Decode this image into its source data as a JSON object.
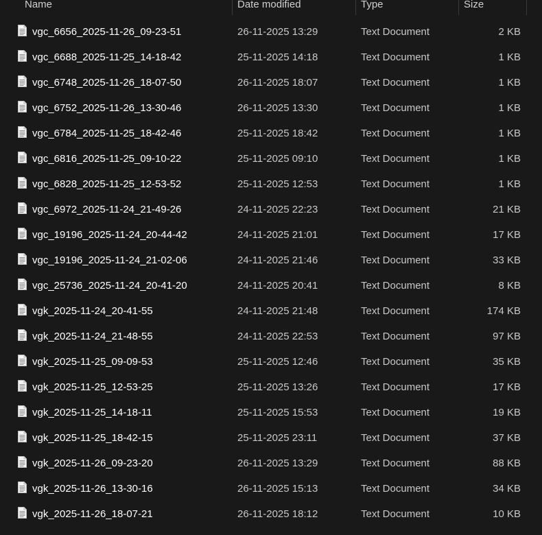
{
  "columns": {
    "name": "Name",
    "date": "Date modified",
    "type": "Type",
    "size": "Size"
  },
  "icon": "text-file-icon",
  "rows": [
    {
      "name": "vgc_6656_2025-11-26_09-23-51",
      "date": "26-11-2025 13:29",
      "type": "Text Document",
      "size": "2 KB"
    },
    {
      "name": "vgc_6688_2025-11-25_14-18-42",
      "date": "25-11-2025 14:18",
      "type": "Text Document",
      "size": "1 KB"
    },
    {
      "name": "vgc_6748_2025-11-26_18-07-50",
      "date": "26-11-2025 18:07",
      "type": "Text Document",
      "size": "1 KB"
    },
    {
      "name": "vgc_6752_2025-11-26_13-30-46",
      "date": "26-11-2025 13:30",
      "type": "Text Document",
      "size": "1 KB"
    },
    {
      "name": "vgc_6784_2025-11-25_18-42-46",
      "date": "25-11-2025 18:42",
      "type": "Text Document",
      "size": "1 KB"
    },
    {
      "name": "vgc_6816_2025-11-25_09-10-22",
      "date": "25-11-2025 09:10",
      "type": "Text Document",
      "size": "1 KB"
    },
    {
      "name": "vgc_6828_2025-11-25_12-53-52",
      "date": "25-11-2025 12:53",
      "type": "Text Document",
      "size": "1 KB"
    },
    {
      "name": "vgc_6972_2025-11-24_21-49-26",
      "date": "24-11-2025 22:23",
      "type": "Text Document",
      "size": "21 KB"
    },
    {
      "name": "vgc_19196_2025-11-24_20-44-42",
      "date": "24-11-2025 21:01",
      "type": "Text Document",
      "size": "17 KB"
    },
    {
      "name": "vgc_19196_2025-11-24_21-02-06",
      "date": "24-11-2025 21:46",
      "type": "Text Document",
      "size": "33 KB"
    },
    {
      "name": "vgc_25736_2025-11-24_20-41-20",
      "date": "24-11-2025 20:41",
      "type": "Text Document",
      "size": "8 KB"
    },
    {
      "name": "vgk_2025-11-24_20-41-55",
      "date": "24-11-2025 21:48",
      "type": "Text Document",
      "size": "174 KB"
    },
    {
      "name": "vgk_2025-11-24_21-48-55",
      "date": "24-11-2025 22:53",
      "type": "Text Document",
      "size": "97 KB"
    },
    {
      "name": "vgk_2025-11-25_09-09-53",
      "date": "25-11-2025 12:46",
      "type": "Text Document",
      "size": "35 KB"
    },
    {
      "name": "vgk_2025-11-25_12-53-25",
      "date": "25-11-2025 13:26",
      "type": "Text Document",
      "size": "17 KB"
    },
    {
      "name": "vgk_2025-11-25_14-18-11",
      "date": "25-11-2025 15:53",
      "type": "Text Document",
      "size": "19 KB"
    },
    {
      "name": "vgk_2025-11-25_18-42-15",
      "date": "25-11-2025 23:11",
      "type": "Text Document",
      "size": "37 KB"
    },
    {
      "name": "vgk_2025-11-26_09-23-20",
      "date": "26-11-2025 13:29",
      "type": "Text Document",
      "size": "88 KB"
    },
    {
      "name": "vgk_2025-11-26_13-30-16",
      "date": "26-11-2025 15:13",
      "type": "Text Document",
      "size": "34 KB"
    },
    {
      "name": "vgk_2025-11-26_18-07-21",
      "date": "26-11-2025 18:12",
      "type": "Text Document",
      "size": "10 KB"
    }
  ]
}
